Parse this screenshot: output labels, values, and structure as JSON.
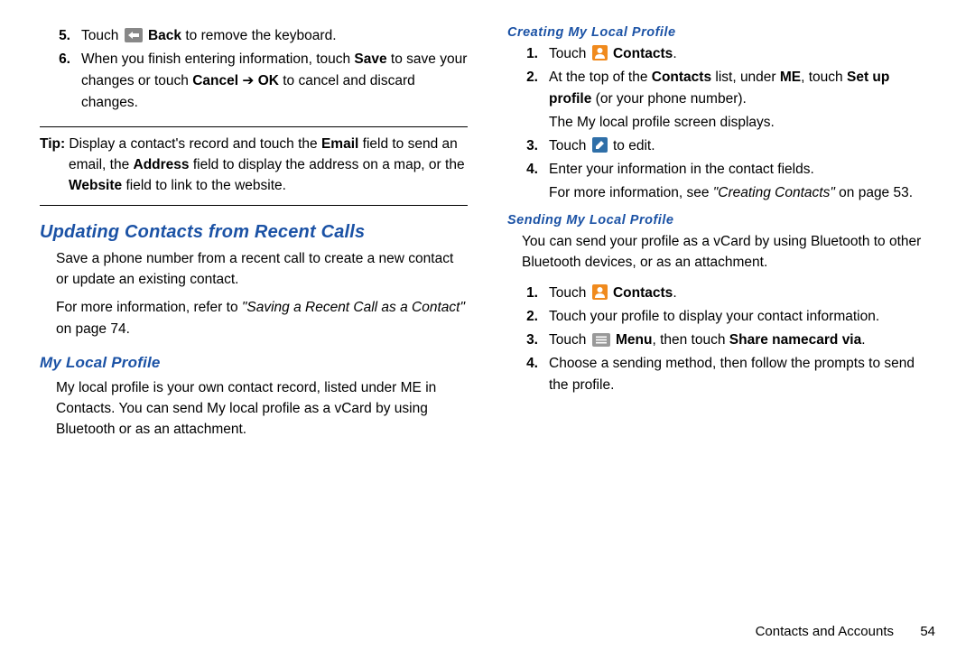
{
  "left": {
    "step5": {
      "num": "5.",
      "pre": "Touch ",
      "btn": "Back",
      "post": " to remove the keyboard."
    },
    "step6": {
      "num": "6.",
      "a": "When you finish entering information, touch ",
      "b": "Save",
      "c": " to save your changes or touch ",
      "d": "Cancel",
      "e": " ➔ ",
      "f": "OK",
      "g": " to cancel and discard changes."
    },
    "tip": {
      "a": "Tip:",
      "b": " Display a contact's record and touch the ",
      "c": "Email",
      "d": " field to send an email, the ",
      "e": "Address",
      "f": " field to display the address on a map, or the ",
      "g": "Website",
      "h": " field to link to the website."
    },
    "h_update": "Updating Contacts from Recent Calls",
    "p_update1": "Save a phone number from a recent call to create a new contact or update an existing contact.",
    "p_update2_a": "For more information, refer to ",
    "p_update2_b": "\"Saving a Recent Call as a Contact\"",
    "p_update2_c": " on page 74.",
    "h_mylocal": "My Local Profile",
    "p_mylocal": "My local profile is your own contact record, listed under ME in Contacts. You can send My local profile as a vCard by using Bluetooth or as an attachment."
  },
  "right": {
    "h_create": "Creating My Local Profile",
    "c_s1": {
      "num": "1.",
      "a": "Touch ",
      "b": "Contacts",
      "c": "."
    },
    "c_s2": {
      "num": "2.",
      "a": "At the top of the ",
      "b": "Contacts",
      "c": " list, under ",
      "d": "ME",
      "e": ", touch ",
      "f": "Set up profile",
      "g": " (or your phone number)."
    },
    "c_s2_extra": "The My local profile screen displays.",
    "c_s3": {
      "num": "3.",
      "a": "Touch ",
      "b": " to edit."
    },
    "c_s4": {
      "num": "4.",
      "a": "Enter your information in the contact fields."
    },
    "c_s4_extra_a": "For more information, see ",
    "c_s4_extra_b": "\"Creating Contacts\"",
    "c_s4_extra_c": " on page 53.",
    "h_send": "Sending My Local Profile",
    "p_send": "You can send your profile as a vCard by using Bluetooth to other Bluetooth devices, or as an attachment.",
    "s_s1": {
      "num": "1.",
      "a": "Touch ",
      "b": "Contacts",
      "c": "."
    },
    "s_s2": {
      "num": "2.",
      "a": "Touch your profile to display your contact information."
    },
    "s_s3": {
      "num": "3.",
      "a": "Touch ",
      "b": "Menu",
      "c": ", then touch ",
      "d": "Share namecard via",
      "e": "."
    },
    "s_s4": {
      "num": "4.",
      "a": "Choose a sending method, then follow the prompts to send the profile."
    }
  },
  "footer": {
    "section": "Contacts and Accounts",
    "page": "54"
  }
}
